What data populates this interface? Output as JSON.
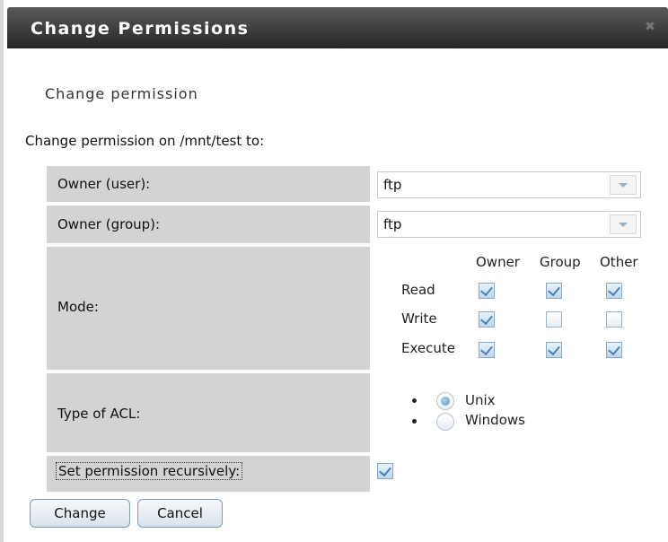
{
  "dialog": {
    "title": "Change Permissions",
    "subtitle": "Change permission",
    "intro": "Change permission on /mnt/test to:"
  },
  "form": {
    "owner_user": {
      "label": "Owner (user):",
      "value": "ftp"
    },
    "owner_group": {
      "label": "Owner (group):",
      "value": "ftp"
    },
    "mode": {
      "label": "Mode:",
      "columns": [
        "Owner",
        "Group",
        "Other"
      ],
      "rows": [
        {
          "label": "Read",
          "checked": [
            true,
            true,
            true
          ]
        },
        {
          "label": "Write",
          "checked": [
            true,
            false,
            false
          ]
        },
        {
          "label": "Execute",
          "checked": [
            true,
            true,
            true
          ]
        }
      ]
    },
    "acl": {
      "label": "Type of ACL:",
      "options": [
        "Unix",
        "Windows"
      ],
      "selected": "Unix"
    },
    "recursive": {
      "label": "Set permission recursively:",
      "checked": true
    }
  },
  "buttons": {
    "change": "Change",
    "cancel": "Cancel"
  }
}
